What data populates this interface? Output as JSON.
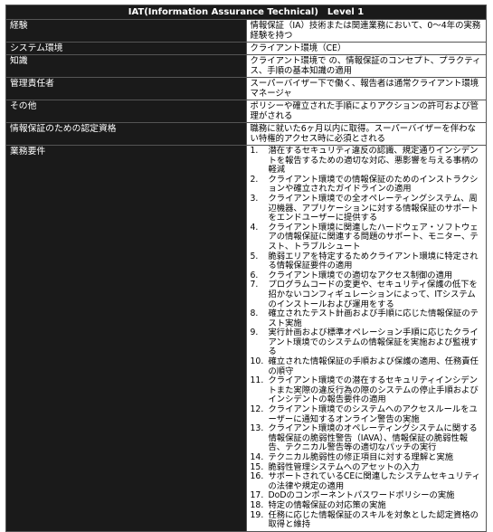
{
  "title": "IAT(Information Assurance Technical)　Level 1",
  "rows": [
    {
      "label": "経験",
      "value": "情報保証（IA）技術または関連業務において、0〜4年の実務経験を持つ"
    },
    {
      "label": "システム環境",
      "value": "クライアント環境（CE）"
    },
    {
      "label": "知識",
      "value": "クライアント環境で の、情報保証のコンセプト、プラクティス、手順の基本知識の適用"
    },
    {
      "label": "管理責任者",
      "value": "スーパーバイザー下で働く、報告者は通常クライアント環境マネージャ"
    },
    {
      "label": "その他",
      "value": "ポリシーや確立された手順によりアクションの許可および管理がされる"
    },
    {
      "label": "情報保証のための認定資格",
      "value": "職務に就いた6ヶ月以内に取得。スーパーバイザーを伴わない特権的アクセス時に必須とされる"
    }
  ],
  "requirements": {
    "label": "業務要件",
    "items": [
      {
        "num": "1.",
        "text": "潜在するセキュリティ違反の認識、規定通りインシデントを報告するための適切な対応、悪影響を与える事柄の軽減"
      },
      {
        "num": "2.",
        "text": "クライアント環境での情報保証のためのインストラクションや確立されたガイドラインの適用"
      },
      {
        "num": "3.",
        "text": "クライアント環境での全オペレーティングシステム、周辺機器、アプリケーションに対する情報保証のサポートをエンドユーザーに提供する"
      },
      {
        "num": "4.",
        "text": "クライアント環境に関連したハードウェア・ソフトウェアの情報保証に関連する問題のサポート、モニター、テスト、トラブルシュート"
      },
      {
        "num": "5.",
        "text": "脆弱エリアを特定するためクライアント環境に特定される情報保証要件の適用"
      },
      {
        "num": "6.",
        "text": "クライアント環境での適切なアクセス制御の適用"
      },
      {
        "num": "7.",
        "text": "プログラムコードの変更や、セキュリティ保護の低下を招かないコンフィギュレーションによって、ITシステムのインストールおよび運用をする"
      },
      {
        "num": "8.",
        "text": "確立されたテスト計画および手順に応じた情報保証のテスト実施"
      },
      {
        "num": "9.",
        "text": "実行計画および標準オペレーション手順に応じたクライアント環境でのシステムの情報保証を実施および監視する"
      },
      {
        "num": "10.",
        "text": "確立された情報保証の手順および保護の適用、任務責任の順守"
      },
      {
        "num": "11.",
        "text": "クライアント環境での潜在するセキュリティインシデントまた実際の違反行為の際のシステムの停止手順およびインシデントの報告要件の適用"
      },
      {
        "num": "12.",
        "text": "クライアント環境でのシステムへのアクセスルールをユーザーに通知するオンライン警告の実施"
      },
      {
        "num": "13.",
        "text": "クライアント環境のオペレーティングシステムに関する情報保証の脆弱性警告（IAVA）、情報保証の脆弱性報告、テクニカル警告等の適切なパッチの実行"
      },
      {
        "num": "14.",
        "text": "テクニカル脆弱性の修正項目に対する理解と実施"
      },
      {
        "num": "15.",
        "text": "脆弱性管理システムへのアセットの入力"
      },
      {
        "num": "16.",
        "text": "サポートされているCEに関連したシステムセキュリティの法律や規定の適用"
      },
      {
        "num": "17.",
        "text": "DoDのコンポーネントパスワードポリシーの実施"
      },
      {
        "num": "18.",
        "text": "特定の情報保証の対応策の実施"
      },
      {
        "num": "19.",
        "text": "任務に応じた情報保証のスキルを対象とした認定資格の取得と維持"
      }
    ]
  }
}
